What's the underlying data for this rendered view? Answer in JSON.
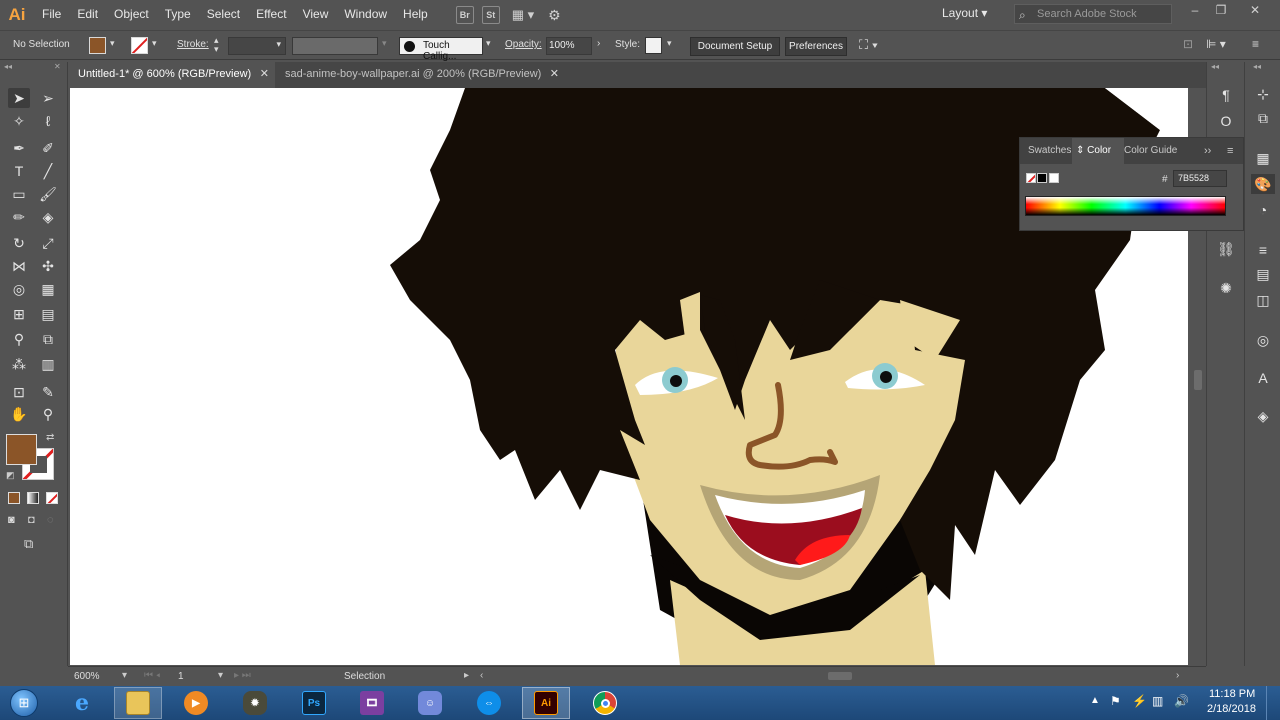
{
  "app": {
    "logo": "Ai",
    "menu": [
      "File",
      "Edit",
      "Object",
      "Type",
      "Select",
      "Effect",
      "View",
      "Window",
      "Help"
    ],
    "bridge_label": "Br",
    "stock_label": "St",
    "workspace": "Layout",
    "stock_search_placeholder": "Search Adobe Stock"
  },
  "control_bar": {
    "selection": "No Selection",
    "stroke_label": "Stroke:",
    "brush": "Touch Callig...",
    "opacity_label": "Opacity:",
    "opacity_value": "100%",
    "style_label": "Style:",
    "document_setup": "Document Setup",
    "preferences": "Preferences",
    "fill_color": "#8B5528"
  },
  "tabs": [
    {
      "label": "Untitled-1* @ 600% (RGB/Preview)",
      "active": true
    },
    {
      "label": "sad-anime-boy-wallpaper.ai @ 200% (RGB/Preview)",
      "active": false
    }
  ],
  "color_panel": {
    "tabs": [
      "Swatches",
      "Color",
      "Color Guide"
    ],
    "active_tab": "Color",
    "hash": "#",
    "hex_value": "7B5528"
  },
  "status": {
    "zoom": "600%",
    "artboard": "1",
    "tool": "Selection"
  },
  "taskbar": {
    "time": "11:18 PM",
    "date": "2/18/2018",
    "ps_label": "Ps",
    "ai_label": "Ai"
  },
  "colors": {
    "hair": "#150d06",
    "skin": "#e9d69a",
    "nose": "#8b5528",
    "mouth": "#9b0d1e",
    "tongue": "#ff1a1a",
    "iris": "#8ccbd0",
    "ai_orange": "#ff9a00"
  }
}
